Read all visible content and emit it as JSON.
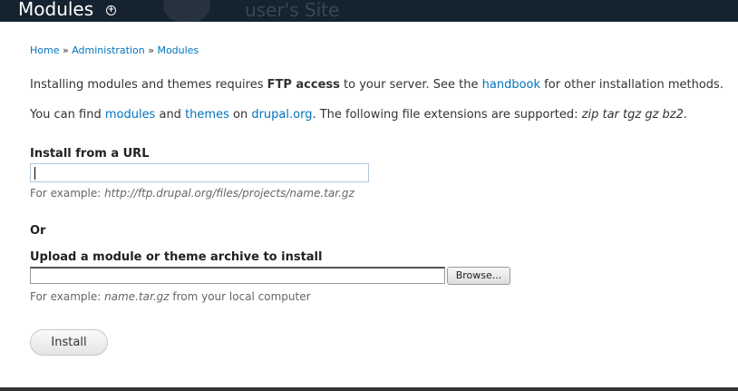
{
  "header": {
    "title": "Modules",
    "site_name": "user's Site"
  },
  "breadcrumb": {
    "home": "Home",
    "sep1": " » ",
    "admin": "Administration",
    "sep2": " » ",
    "modules": "Modules"
  },
  "intro": {
    "p1_a": "Installing modules and themes requires ",
    "p1_b": "FTP access",
    "p1_c": " to your server. See the ",
    "p1_link": "handbook",
    "p1_d": " for other installation methods.",
    "p2_a": "You can find ",
    "p2_link1": "modules",
    "p2_b": " and ",
    "p2_link2": "themes",
    "p2_c": " on ",
    "p2_link3": "drupal.org",
    "p2_d": ". The following file extensions are supported: ",
    "p2_ext": "zip tar tgz gz bz2",
    "p2_e": "."
  },
  "url_field": {
    "label": "Install from a URL",
    "value": "",
    "desc_prefix": "For example: ",
    "desc_example": "http://ftp.drupal.org/files/projects/name.tar.gz"
  },
  "or_label": "Or",
  "upload_field": {
    "label": "Upload a module or theme archive to install",
    "browse_label": "Browse...",
    "desc_prefix": "For example: ",
    "desc_example": "name.tar.gz",
    "desc_suffix": " from your local computer"
  },
  "install_button": "Install"
}
